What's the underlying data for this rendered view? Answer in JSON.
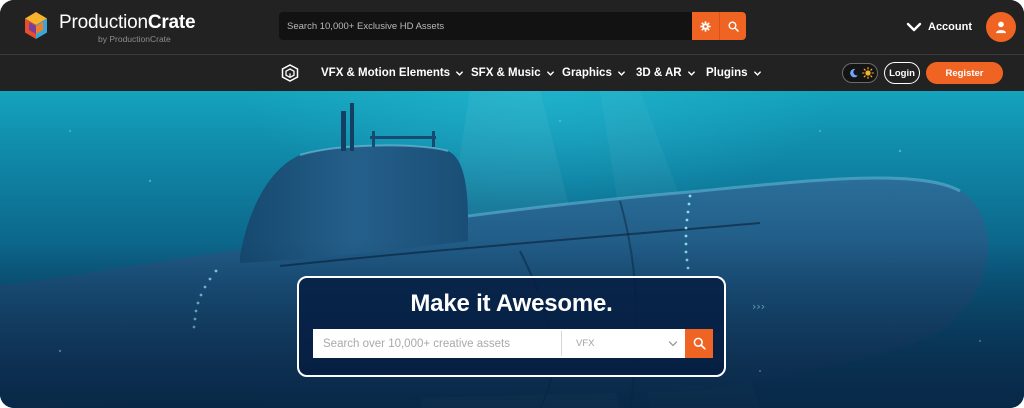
{
  "brand": {
    "name_regular": "Production",
    "name_bold": "Crate",
    "byline": "by ProductionCrate",
    "mark_colors": [
      "#e94e2b",
      "#f7b32b",
      "#3aa7d8",
      "#7b3fa0"
    ]
  },
  "top_search": {
    "placeholder": "Search 10,000+ Exclusive HD Assets"
  },
  "account": {
    "label": "Account"
  },
  "nav": {
    "items": [
      {
        "label": "VFX & Motion Elements"
      },
      {
        "label": "SFX & Music"
      },
      {
        "label": "Graphics"
      },
      {
        "label": "3D & AR"
      },
      {
        "label": "Plugins"
      }
    ],
    "login_label": "Login",
    "register_label": "Register"
  },
  "hero": {
    "title": "Make it Awesome.",
    "search_placeholder": "Search over 10,000+ creative assets",
    "category_selected": "VFX"
  },
  "colors": {
    "accent": "#f06423",
    "bar_bg": "#222222",
    "hero_box": "#061e42"
  },
  "icons": [
    "logo-mark",
    "gear-icon",
    "search-icon",
    "chevron-down-icon",
    "user-icon",
    "crate-home-icon",
    "moon-icon",
    "sun-icon"
  ]
}
